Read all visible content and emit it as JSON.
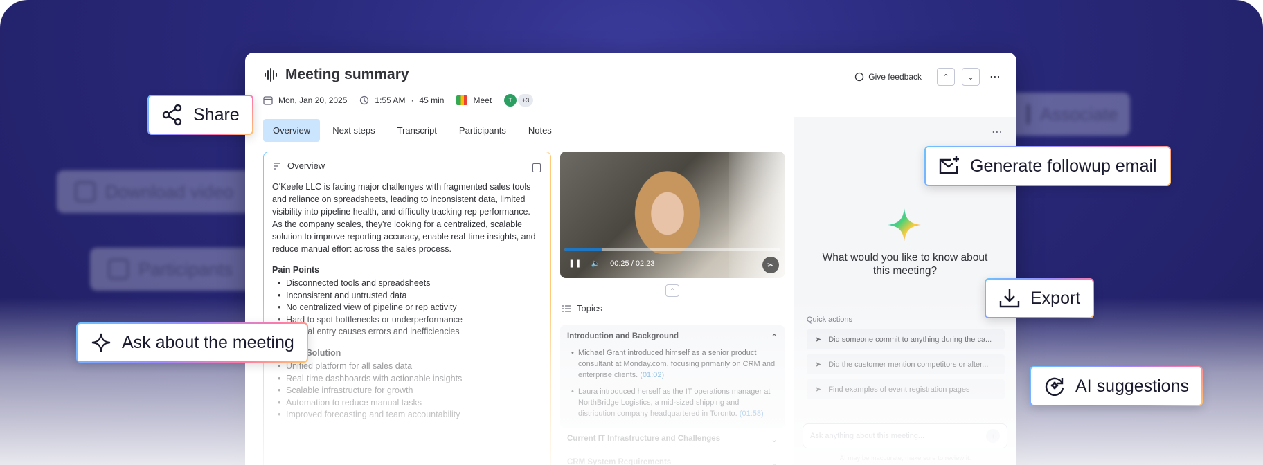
{
  "background_chips": {
    "associate": "Associate",
    "download": "Download video",
    "participants": "Participants"
  },
  "header": {
    "title": "Meeting summary",
    "date": "Mon, Jan 20, 2025",
    "time": "1:55 AM",
    "duration_sep": "·",
    "duration": "45 min",
    "platform": "Meet",
    "avatar_initial": "T",
    "more_participants": "+3",
    "feedback_label": "Give feedback"
  },
  "tabs": [
    "Overview",
    "Next steps",
    "Transcript",
    "Participants",
    "Notes"
  ],
  "overview": {
    "heading": "Overview",
    "paragraph": "O'Keefe LLC is facing major challenges with fragmented sales tools and reliance on spreadsheets, leading to inconsistent data, limited visibility into pipeline health, and difficulty tracking rep performance. As the company scales, they're looking for a centralized, scalable solution to improve reporting accuracy, enable real-time insights, and reduce manual effort across the sales process.",
    "pain_points_title": "Pain Points",
    "pain_points": [
      "Disconnected tools and spreadsheets",
      "Inconsistent and untrusted data",
      "No centralized view of pipeline or rep activity",
      "Hard to spot bottlenecks or underperformance",
      "Manual entry causes errors and inefficiencies"
    ],
    "solution_title": "Desired Solution",
    "solution": [
      "Unified platform for all sales data",
      "Real-time dashboards with actionable insights",
      "Scalable infrastructure for growth",
      "Automation to reduce manual tasks",
      "Improved forecasting and team accountability"
    ]
  },
  "video": {
    "time": "00:25 / 02:23",
    "progress": 0.175
  },
  "topics": {
    "heading": "Topics",
    "expanded": {
      "title": "Introduction and Background",
      "items": [
        {
          "text": "Michael Grant introduced himself as a senior product consultant at Monday.com, focusing primarily on CRM and enterprise clients.",
          "ts": "(01:02)"
        },
        {
          "text": "Laura introduced herself as the IT operations manager at NorthBridge Logistics, a mid-sized shipping and distribution company headquartered in Toronto.",
          "ts": "(01:58)"
        }
      ]
    },
    "collapsed": [
      "Current IT Infrastructure and Challenges",
      "CRM System Requirements"
    ]
  },
  "ai_panel": {
    "question": "What would you like to know about this meeting?",
    "quick_actions_label": "Quick actions",
    "quick_actions": [
      "Did someone commit to anything during the ca...",
      "Did the customer mention competitors or alter...",
      "Find examples of event registration pages"
    ],
    "input_placeholder": "Ask anything about this meeting...",
    "disclaimer": "AI may be inaccurate, make sure to review it."
  },
  "chips": {
    "share": "Share",
    "generate": "Generate followup email",
    "export": "Export",
    "ask": "Ask about the meeting",
    "ai_suggestions": "AI suggestions"
  }
}
